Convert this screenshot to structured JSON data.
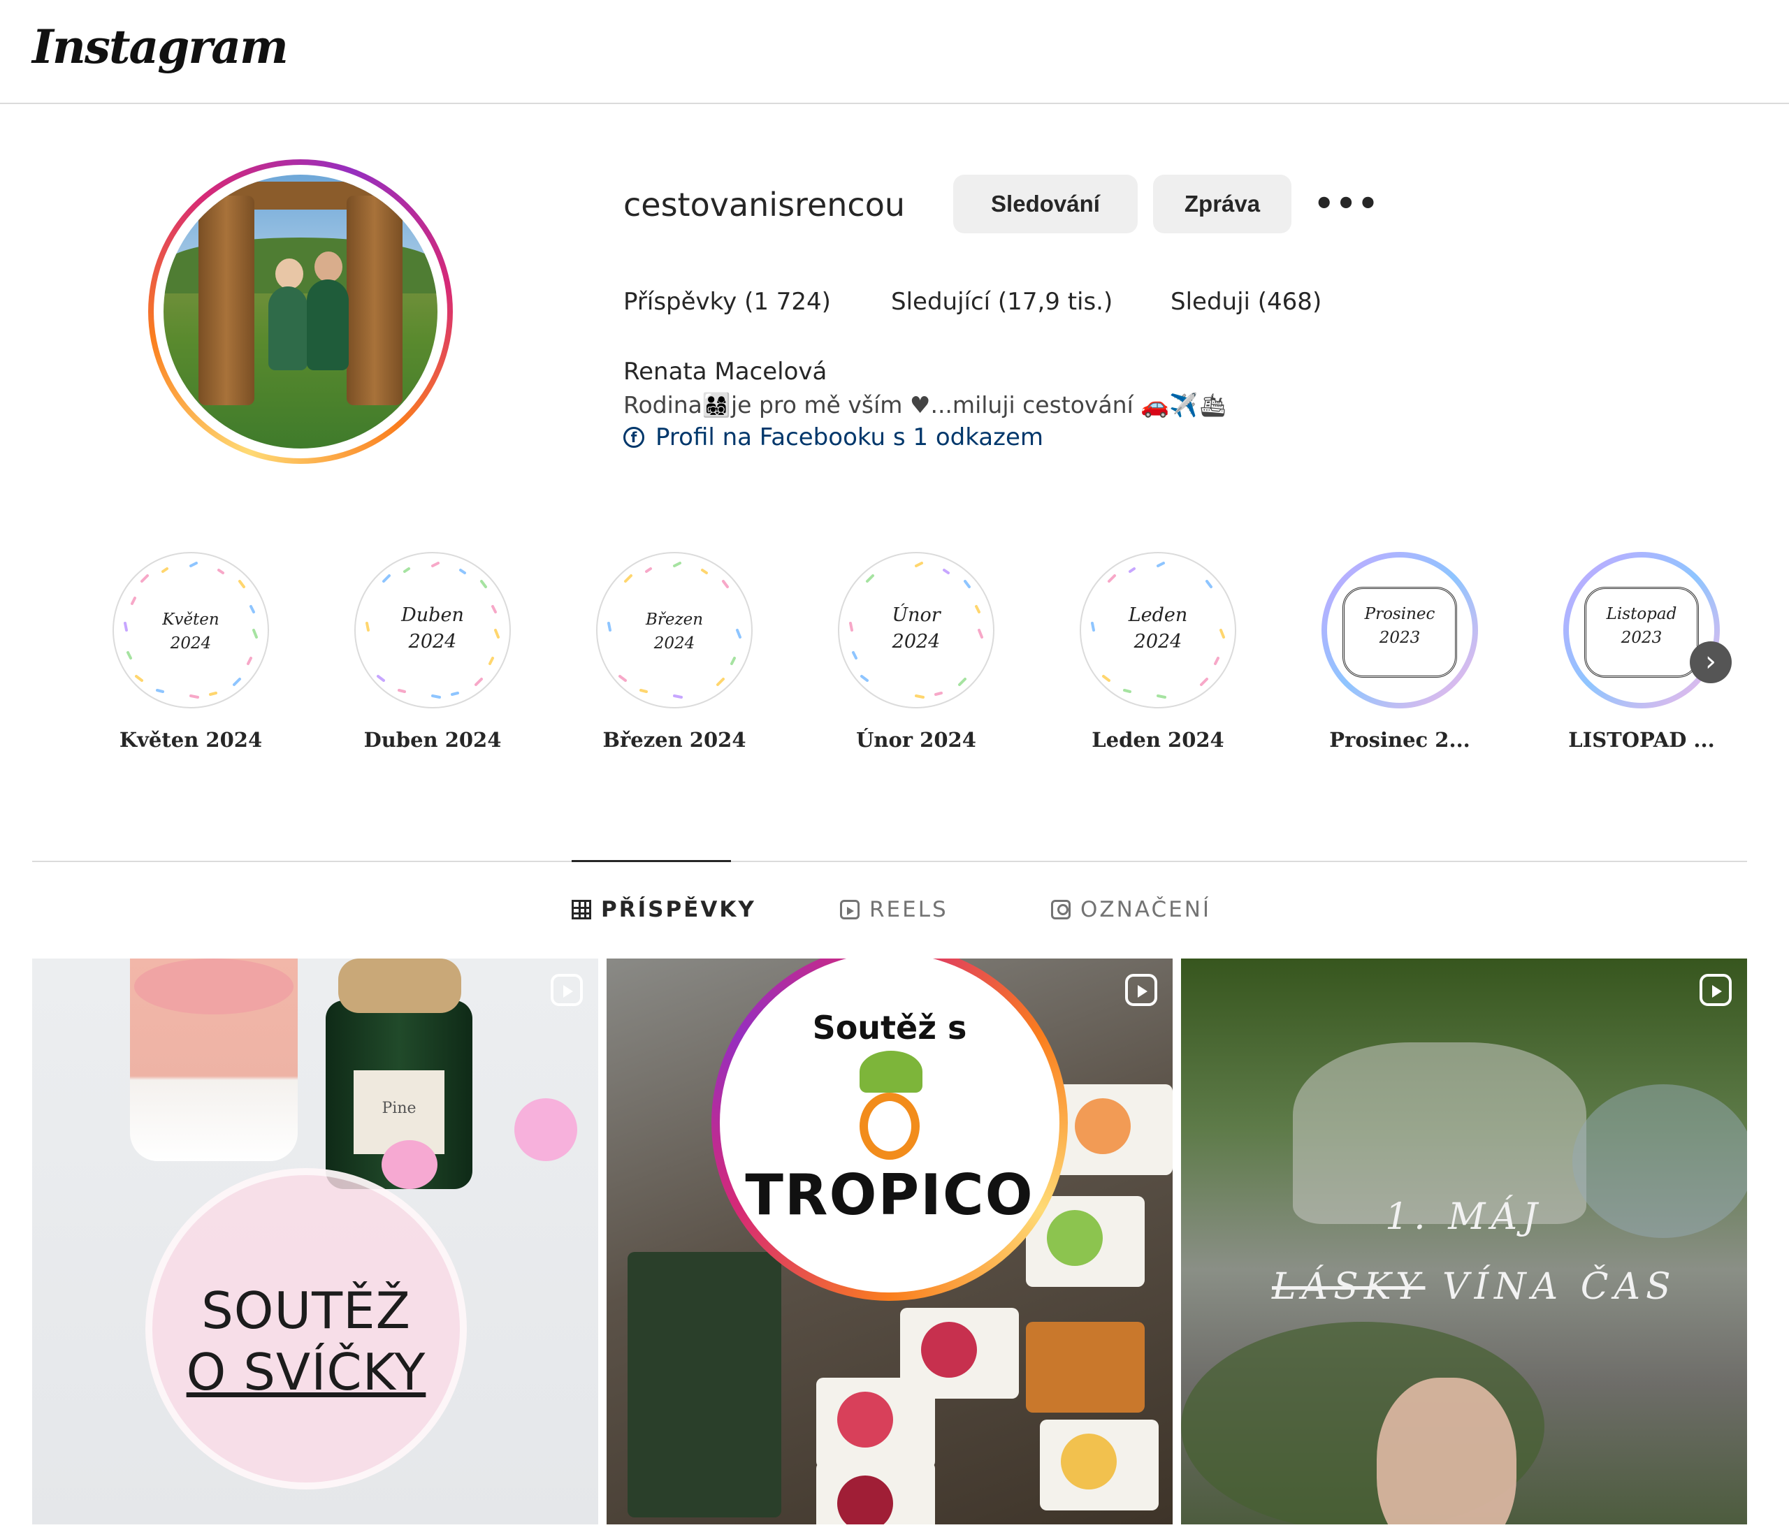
{
  "header": {
    "logo": "Instagram"
  },
  "profile": {
    "username": "cestovanisrencou",
    "follow_button": "Sledování",
    "message_button": "Zpráva",
    "more_button": "•••",
    "stats": {
      "posts": "Příspěvky (1 724)",
      "followers": "Sledující (17,9 tis.)",
      "following": "Sleduji (468)"
    },
    "full_name": "Renata Macelová",
    "bio_text": "Rodina👨‍👩‍👧‍👦je pro mě vším ♥...miluji cestování 🚗✈️🛳",
    "facebook_link": "Profil na Facebooku s 1 odkazem"
  },
  "highlights": [
    {
      "label": "Květen 2024",
      "cover_line1": "Květen",
      "cover_line2": "2024"
    },
    {
      "label": "Duben 2024",
      "cover_line1": "Duben",
      "cover_line2": "2024"
    },
    {
      "label": "Březen 2024",
      "cover_line1": "Březen",
      "cover_line2": "2024"
    },
    {
      "label": "Únor 2024",
      "cover_line1": "Únor",
      "cover_line2": "2024"
    },
    {
      "label": "Leden 2024",
      "cover_line1": "Leden",
      "cover_line2": "2024"
    },
    {
      "label": "Prosinec 2...",
      "cover_line1": "Prosinec",
      "cover_line2": "2023"
    },
    {
      "label": "LISTOPAD ...",
      "cover_line1": "Listopad",
      "cover_line2": "2023"
    }
  ],
  "tabs": [
    {
      "label": "PŘÍSPĚVKY",
      "active": true
    },
    {
      "label": "REELS",
      "active": false
    },
    {
      "label": "OZNAČENÍ",
      "active": false
    }
  ],
  "posts": [
    {
      "line1": "SOUTĚŽ",
      "line2": "O SVÍČKY",
      "candle_label": "Pine"
    },
    {
      "line1": "Soutěž s",
      "brand": "TROPICO"
    },
    {
      "line1": "1. MÁJ",
      "line2_struck": "LÁSKY",
      "line2_rest": "VÍNA ČAS"
    }
  ],
  "colors": {
    "link": "#00376b",
    "button_bg": "#efefef",
    "story_gradient": [
      "#feda75",
      "#fa7e1e",
      "#d62976",
      "#962fbf"
    ]
  }
}
